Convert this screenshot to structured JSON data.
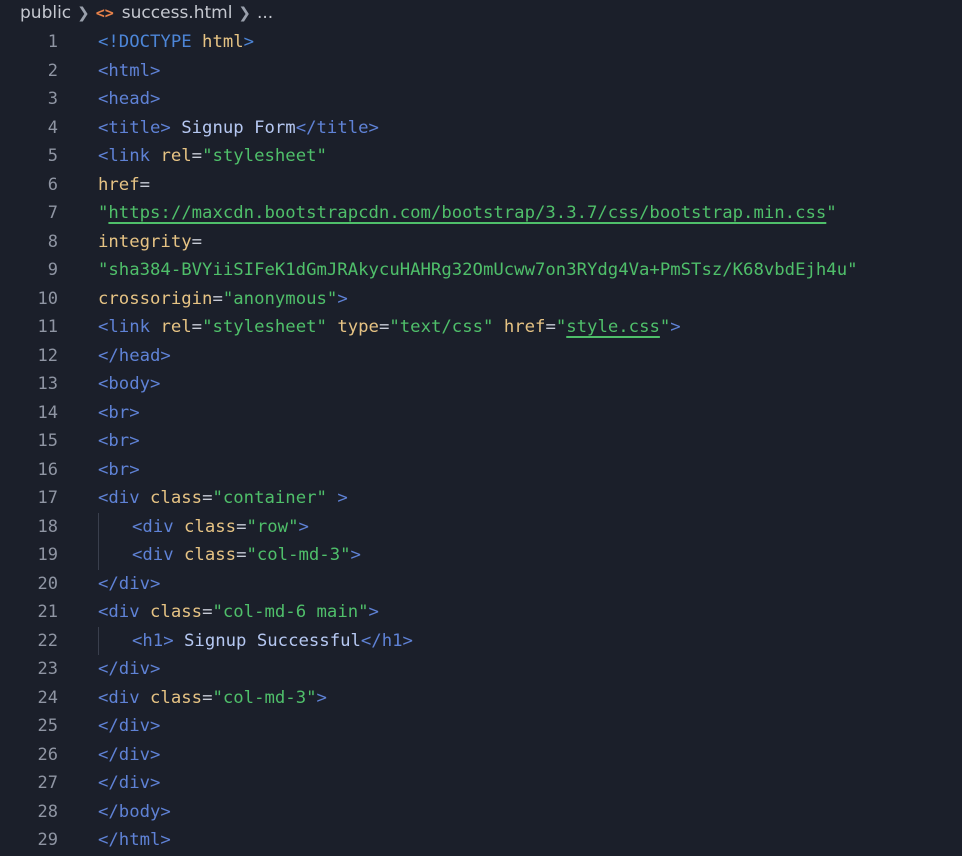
{
  "breadcrumb": {
    "folder": "public",
    "file_icon": "<>",
    "file": "success.html",
    "more": "..."
  },
  "lines": [
    {
      "n": "1",
      "parts": [
        "<!DOCTYPE",
        " ",
        "html",
        ">"
      ]
    },
    {
      "n": "2",
      "parts": [
        "<html>"
      ]
    },
    {
      "n": "3",
      "parts": [
        "<head>"
      ]
    },
    {
      "n": "4",
      "parts": [
        "<title>",
        " Signup Form",
        "</title>"
      ]
    },
    {
      "n": "5",
      "parts": [
        "<link",
        " ",
        "rel",
        "=",
        "\"stylesheet\""
      ]
    },
    {
      "n": "6",
      "parts": [
        "href",
        "="
      ]
    },
    {
      "n": "7",
      "parts": [
        "\"",
        "https://maxcdn.bootstrapcdn.com/bootstrap/3.3.7/css/bootstrap.min.css",
        "\""
      ]
    },
    {
      "n": "8",
      "parts": [
        "integrity",
        "="
      ]
    },
    {
      "n": "9",
      "parts": [
        "\"sha384-BVYiiSIFeK1dGmJRAkycuHAHRg32OmUcww7on3RYdg4Va+PmSTsz/K68vbdEjh4u\""
      ]
    },
    {
      "n": "10",
      "parts": [
        "crossorigin",
        "=",
        "\"anonymous\"",
        ">"
      ]
    },
    {
      "n": "11",
      "parts": [
        "<link",
        " ",
        "rel",
        "=",
        "\"stylesheet\"",
        " ",
        "type",
        "=",
        "\"text/css\"",
        " ",
        "href",
        "=",
        "\"",
        "style.css",
        "\"",
        ">"
      ]
    },
    {
      "n": "12",
      "parts": [
        "</head>"
      ]
    },
    {
      "n": "13",
      "parts": [
        "<body>"
      ]
    },
    {
      "n": "14",
      "parts": [
        "<br>"
      ]
    },
    {
      "n": "15",
      "parts": [
        "<br>"
      ]
    },
    {
      "n": "16",
      "parts": [
        "<br>"
      ]
    },
    {
      "n": "17",
      "parts": [
        "<div",
        " ",
        "class",
        "=",
        "\"container\"",
        " >"
      ]
    },
    {
      "n": "18",
      "parts": [
        "<div",
        " ",
        "class",
        "=",
        "\"row\"",
        ">"
      ]
    },
    {
      "n": "19",
      "parts": [
        "<div",
        " ",
        "class",
        "=",
        "\"col-md-3\"",
        ">"
      ]
    },
    {
      "n": "20",
      "parts": [
        "</div>"
      ]
    },
    {
      "n": "21",
      "parts": [
        "<div",
        " ",
        "class",
        "=",
        "\"col-md-6 main\"",
        ">"
      ]
    },
    {
      "n": "22",
      "parts": [
        "<h1>",
        " Signup Successful",
        "</h1>"
      ]
    },
    {
      "n": "23",
      "parts": [
        "</div>"
      ]
    },
    {
      "n": "24",
      "parts": [
        "<div",
        " ",
        "class",
        "=",
        "\"col-md-3\"",
        ">"
      ]
    },
    {
      "n": "25",
      "parts": [
        "</div>"
      ]
    },
    {
      "n": "26",
      "parts": [
        "</div>"
      ]
    },
    {
      "n": "27",
      "parts": [
        "</div>"
      ]
    },
    {
      "n": "28",
      "parts": [
        "</body>"
      ]
    },
    {
      "n": "29",
      "parts": [
        "</html>"
      ]
    }
  ],
  "colors": {
    "background": "#1b1f2a",
    "tag": "#5f82d6",
    "attribute": "#e6c384",
    "string": "#4fbf6a",
    "text": "#b6c8f2",
    "line_number": "#8f95a3",
    "file_icon": "#e8824a"
  }
}
